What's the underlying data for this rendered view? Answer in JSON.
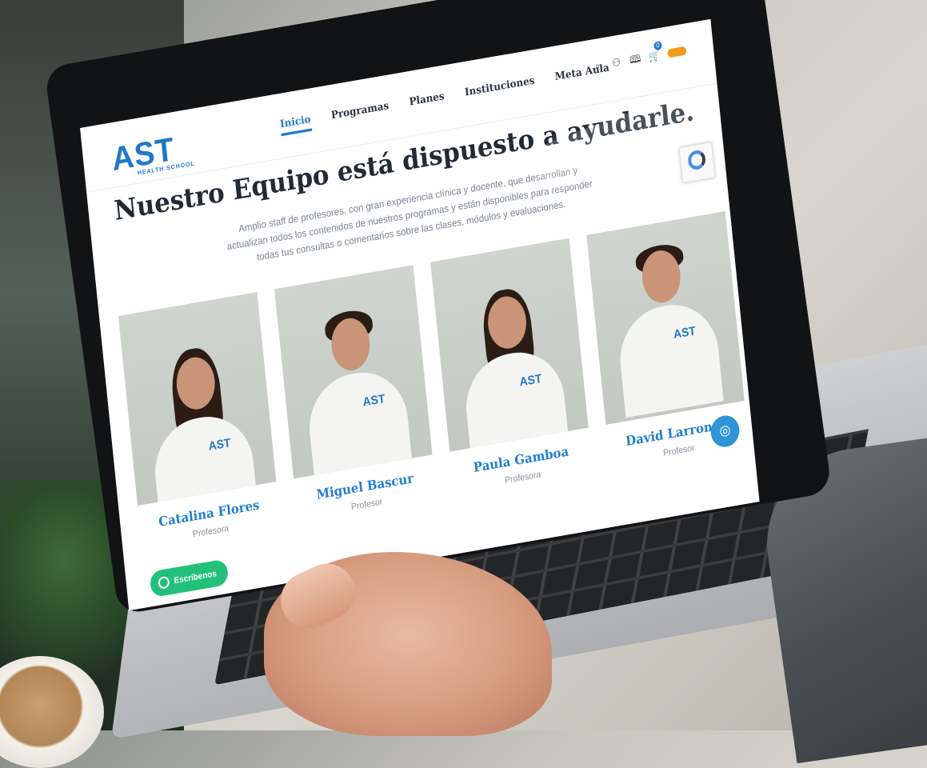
{
  "site": {
    "logo": "AST",
    "logo_sub": "HEALTH SCHOOL",
    "nav": [
      {
        "label": "Inicio",
        "active": true
      },
      {
        "label": "Programas",
        "active": false
      },
      {
        "label": "Planes",
        "active": false
      },
      {
        "label": "Instituciones",
        "active": false
      },
      {
        "label": "Meta Aula",
        "active": false
      }
    ],
    "icons": [
      "search-icon",
      "user-icon",
      "book-icon",
      "cart-icon"
    ],
    "cart_count": "0"
  },
  "hero": {
    "title": "Nuestro Equipo está dispuesto a ayudarle.",
    "subtitle": "Amplio staff de profesores, con gran experiencia clínica y docente, que desarrollan y actualizan todos los contenidos de nuestros programas y están disponibles para responder todas tus consultas o comentarios sobre las clases, módulos y evaluaciones."
  },
  "team": [
    {
      "name": "Catalina Flores",
      "role": "Profesora",
      "badge": "AST",
      "hair": "long-dark"
    },
    {
      "name": "Miguel Bascur",
      "role": "Profesor",
      "badge": "AST",
      "hair": "short-dark"
    },
    {
      "name": "Paula Gamboa",
      "role": "Profesora",
      "badge": "AST",
      "hair": "long-dark"
    },
    {
      "name": "David Larrondo",
      "role": "Profesor",
      "badge": "AST",
      "hair": "short-dark"
    }
  ],
  "widgets": {
    "whatsapp_label": "Escríbenos"
  },
  "colors": {
    "brand": "#1f78c8",
    "whatsapp": "#22c07a",
    "lang_pill": "#f29b1d"
  }
}
